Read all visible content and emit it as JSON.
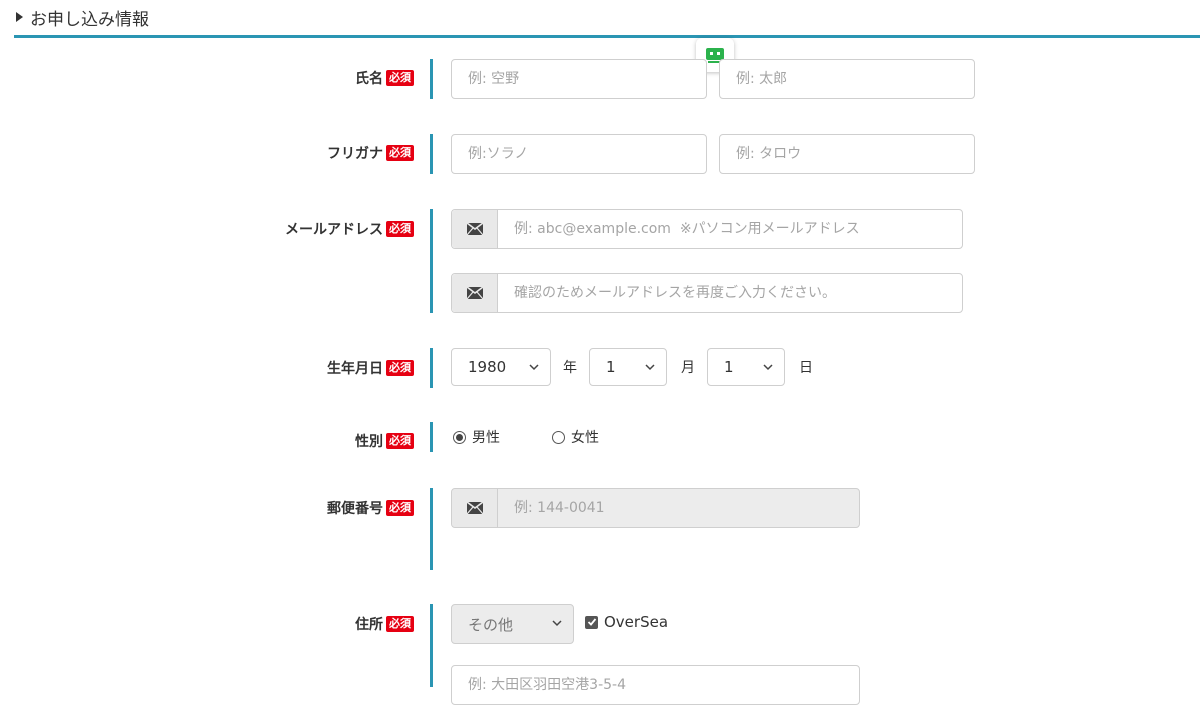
{
  "section": {
    "title": "お申し込み情報"
  },
  "required_badge": "必須",
  "name": {
    "label": "氏名",
    "last_placeholder": "例: 空野",
    "first_placeholder": "例: 太郎"
  },
  "kana": {
    "label": "フリガナ",
    "last_placeholder": "例:ソラノ",
    "first_placeholder": "例: タロウ"
  },
  "email": {
    "label": "メールアドレス",
    "placeholder": "例: abc@example.com  ※パソコン用メールアドレス",
    "confirm_placeholder": "確認のためメールアドレスを再度ご入力ください。",
    "icon": "envelope-icon"
  },
  "birthday": {
    "label": "生年月日",
    "year": "1980",
    "year_unit": "年",
    "month": "1",
    "month_unit": "月",
    "day": "1",
    "day_unit": "日"
  },
  "gender": {
    "label": "性別",
    "male": "男性",
    "female": "女性",
    "selected": "男性"
  },
  "postal": {
    "label": "郵便番号",
    "placeholder": "例: 144-0041"
  },
  "address": {
    "label": "住所",
    "prefecture": "その他",
    "oversea_label": "OverSea",
    "oversea_checked": true,
    "street_placeholder": "例: 大田区羽田空港3-5-4"
  },
  "colors": {
    "accent": "#2a95b3",
    "required": "#e60012",
    "bot": "#2bb24c"
  }
}
